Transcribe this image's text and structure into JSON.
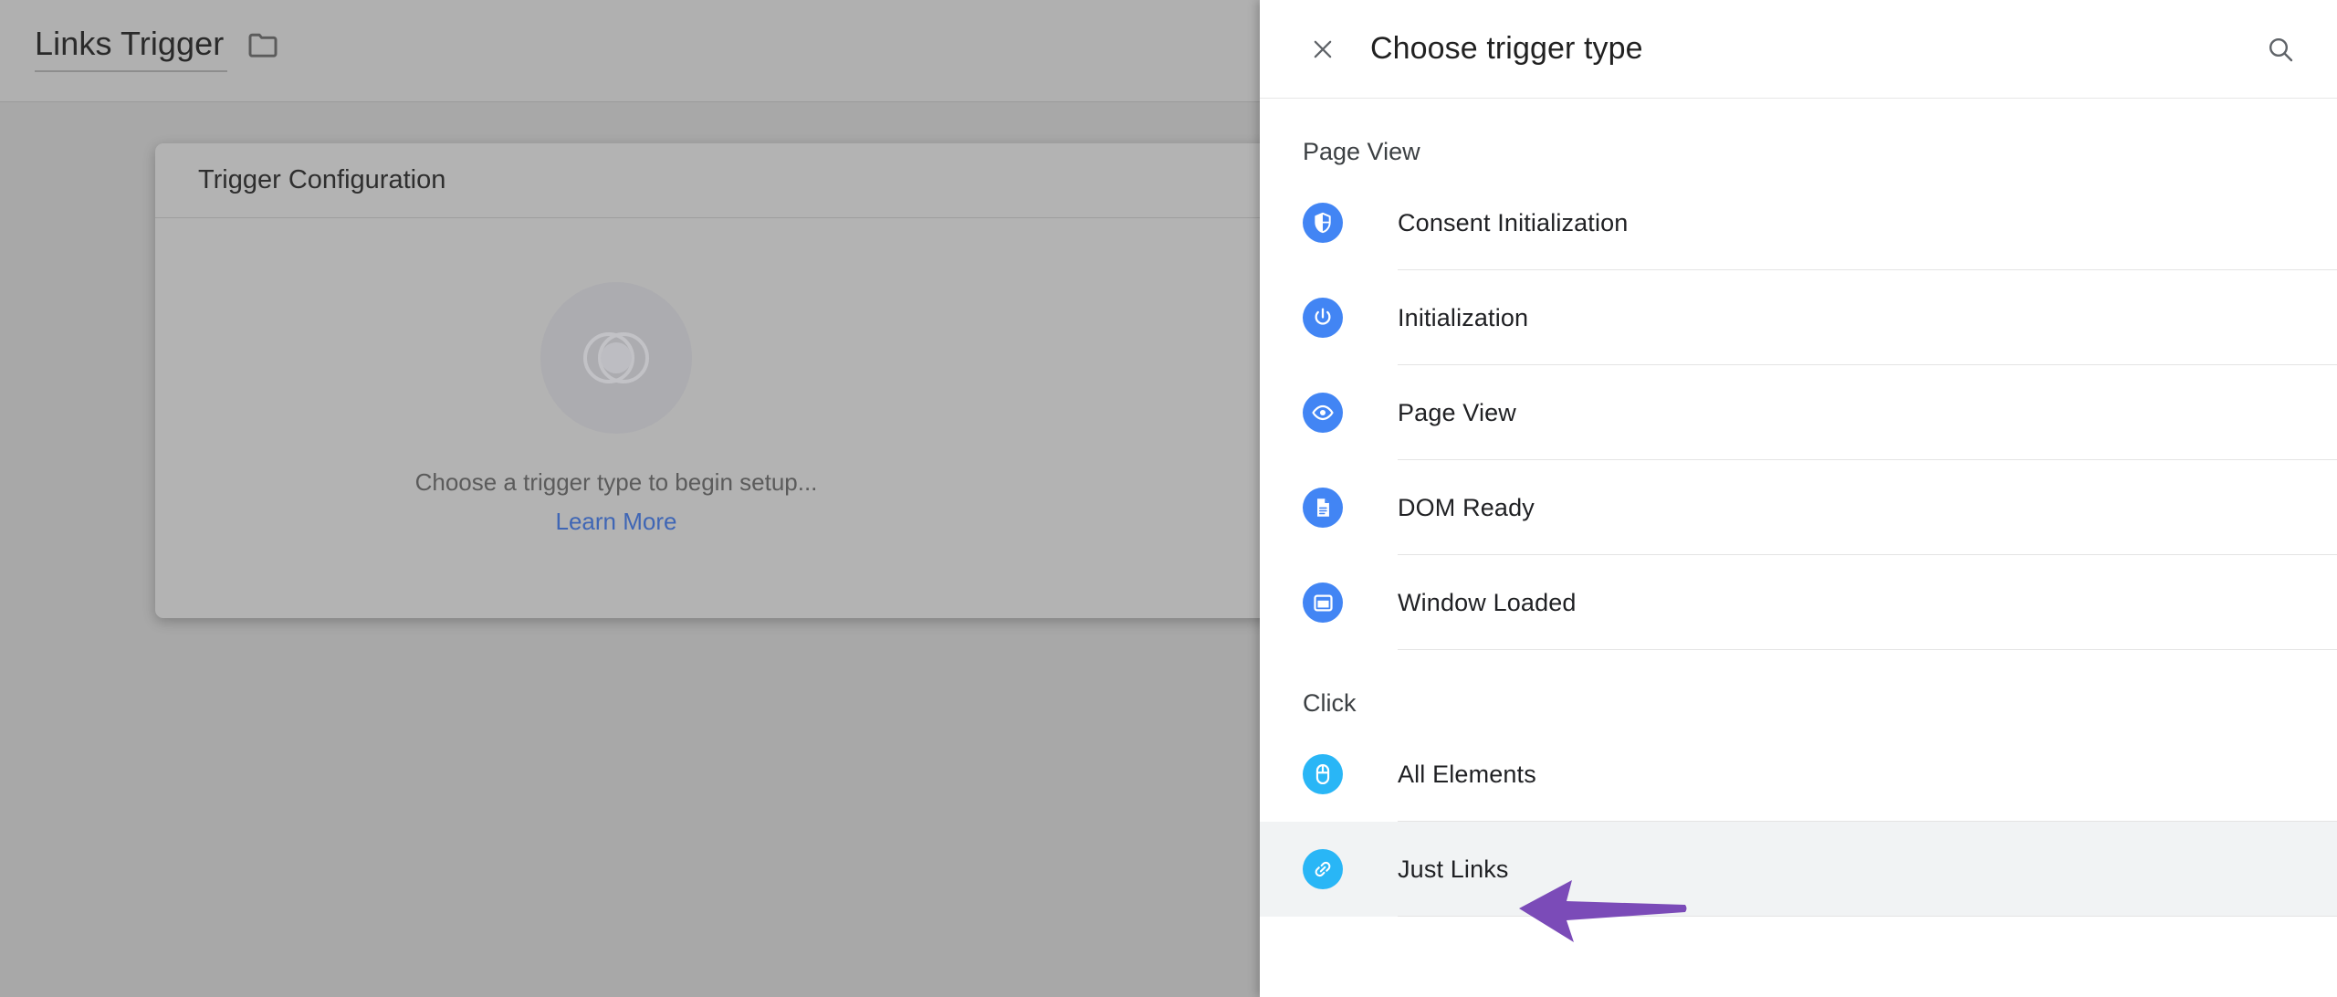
{
  "background_page": {
    "title": "Links Trigger",
    "folder_icon": "folder-icon",
    "card": {
      "header_title": "Trigger Configuration",
      "empty_state": {
        "icon": "overlapping-circles-icon",
        "message": "Choose a trigger type to begin setup...",
        "link_label": "Learn More"
      }
    }
  },
  "panel": {
    "close_icon": "close-icon",
    "title": "Choose trigger type",
    "search_icon": "search-icon",
    "sections": [
      {
        "heading": "Page View",
        "options": [
          {
            "label": "Consent Initialization",
            "icon": "shield-icon",
            "color": "#4285f4",
            "highlighted": false
          },
          {
            "label": "Initialization",
            "icon": "power-icon",
            "color": "#4285f4",
            "highlighted": false
          },
          {
            "label": "Page View",
            "icon": "eye-icon",
            "color": "#4285f4",
            "highlighted": false
          },
          {
            "label": "DOM Ready",
            "icon": "document-icon",
            "color": "#4285f4",
            "highlighted": false
          },
          {
            "label": "Window Loaded",
            "icon": "window-icon",
            "color": "#4285f4",
            "highlighted": false
          }
        ]
      },
      {
        "heading": "Click",
        "options": [
          {
            "label": "All Elements",
            "icon": "mouse-icon",
            "color": "#29b6f6",
            "highlighted": false
          },
          {
            "label": "Just Links",
            "icon": "link-icon",
            "color": "#29b6f6",
            "highlighted": true
          }
        ]
      }
    ]
  },
  "annotation": {
    "shape": "left-arrow",
    "color": "#7b4bb8",
    "points_at": "Just Links"
  },
  "colors": {
    "panel_background": "#ffffff",
    "dimmed_background": "#a8a8a8",
    "accent_blue": "#4285f4",
    "light_blue": "#29b6f6",
    "link_blue": "#3f66b5",
    "highlight_row": "#f1f3f4",
    "annotation_purple": "#7b4bb8"
  }
}
